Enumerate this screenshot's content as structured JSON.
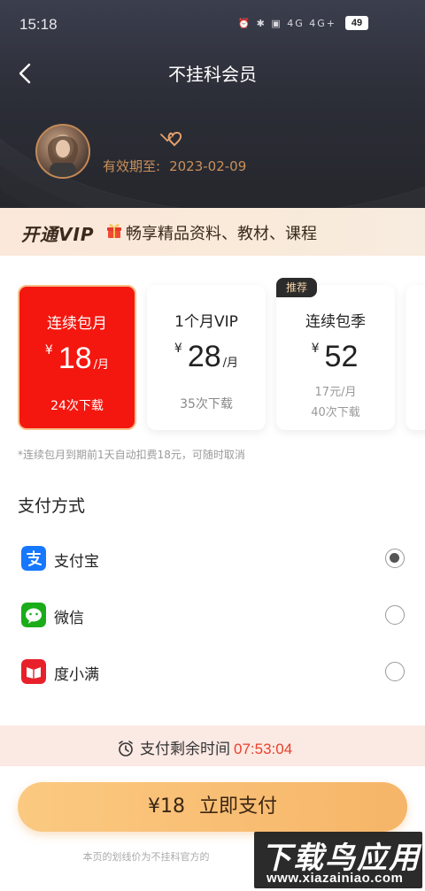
{
  "status_bar": {
    "time": "15:18",
    "icons": "⏰ ✱ ▣ 4G 4G+",
    "battery": "49"
  },
  "header": {
    "title": "不挂科会员"
  },
  "profile": {
    "expire_label": "有效期至:",
    "expire_date": "2023-02-09"
  },
  "promo": {
    "brand": "开通VIP",
    "text": "畅享精品资料、教材、课程"
  },
  "plans": [
    {
      "name": "连续包月",
      "currency": "¥",
      "price": "18",
      "unit": "/月",
      "sub": "24次下载",
      "selected": true
    },
    {
      "name": "1个月VIP",
      "currency": "¥",
      "price": "28",
      "unit": "/月",
      "sub": "35次下载",
      "selected": false
    },
    {
      "name": "连续包季",
      "currency": "¥",
      "price": "52",
      "unit": "",
      "sub_line1": "17元/月",
      "sub_line2": "40次下载",
      "tag": "推荐",
      "selected": false
    }
  ],
  "plans_note": "*连续包月到期前1天自动扣费18元，可随时取消",
  "payment": {
    "title": "支付方式",
    "methods": [
      {
        "label": "支付宝",
        "icon": "alipay-icon",
        "color": "#1677ff",
        "selected": true
      },
      {
        "label": "微信",
        "icon": "wechat-icon",
        "color": "#1aad19",
        "selected": false
      },
      {
        "label": "度小满",
        "icon": "duxiaoman-icon",
        "color": "#e8202a",
        "selected": false
      }
    ]
  },
  "countdown": {
    "label": "支付剩余时间",
    "time": "07:53:04"
  },
  "pay_button": {
    "amount": "¥18",
    "label": "立即支付"
  },
  "footnote": "本页的划线价为不挂科官方的",
  "watermark": {
    "title": "下载鸟应用",
    "url": "www.xiazainiao.com"
  },
  "colors": {
    "accent_red": "#f4170f",
    "gold": "#c9905a",
    "button": "#f6b568"
  }
}
